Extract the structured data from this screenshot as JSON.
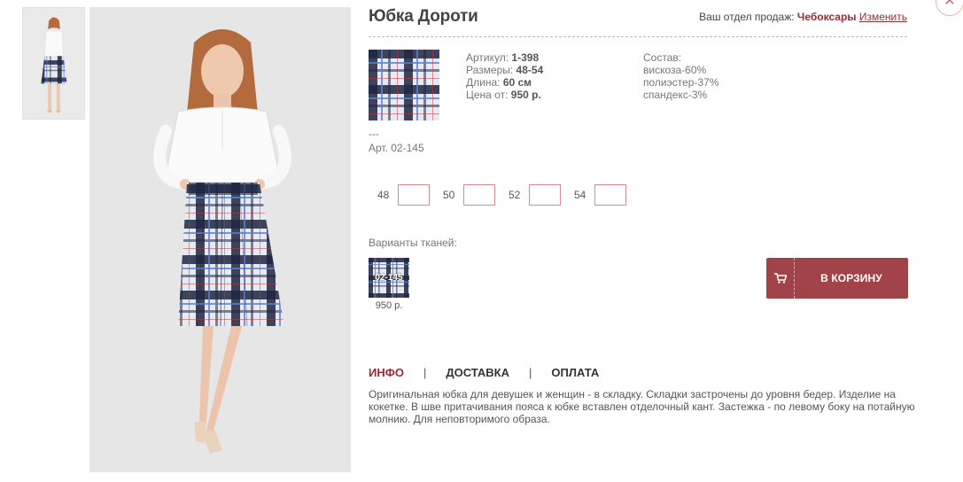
{
  "product": {
    "title": "Юбка Дороти",
    "region_label": "Ваш отдел продаж:",
    "region_city": "Чебоксары",
    "region_change": "Изменить",
    "close_symbol": "✕"
  },
  "specs": {
    "article_label": "Артикул:",
    "article_value": "1-398",
    "sizes_label": "Размеры:",
    "sizes_value": "48-54",
    "length_label": "Длина:",
    "length_value": "60 см",
    "price_label": "Цена от:",
    "price_value": "950 р."
  },
  "composition": {
    "label": "Состав:",
    "items": [
      "вискоза-60%",
      "полиэстер-37%",
      "спандекс-3%"
    ]
  },
  "fabric": {
    "dashes": "---",
    "art": "Арт. 02-145"
  },
  "sizes": [
    {
      "label": "48",
      "value": ""
    },
    {
      "label": "50",
      "value": ""
    },
    {
      "label": "52",
      "value": ""
    },
    {
      "label": "54",
      "value": ""
    }
  ],
  "variants": {
    "label": "Варианты тканей:",
    "items": [
      {
        "code": "02-145",
        "price": "950 р."
      }
    ]
  },
  "cart": {
    "label": "В КОРЗИНУ",
    "icon": "cart-icon"
  },
  "tabs": {
    "items": [
      "ИНФО",
      "ДОСТАВКА",
      "ОПЛАТА"
    ],
    "separator": "|",
    "active_index": 0
  },
  "description": "Оригинальная юбка для девушек и женщин - в складку. Складки застрочены до уровня бедер. Изделие на кокетке. В шве притачивания пояса к юбке вставлен отделочный кант. Застежка - по левому боку на потайную молнию. Для неповторимого образа.",
  "colors": {
    "accent": "#9b2a33",
    "cart_button": "#a2434a",
    "input_border": "#d88a90",
    "plaid_dark": "#1f2640",
    "plaid_blue": "#5b7fd1",
    "plaid_light": "#e7e9f3"
  }
}
